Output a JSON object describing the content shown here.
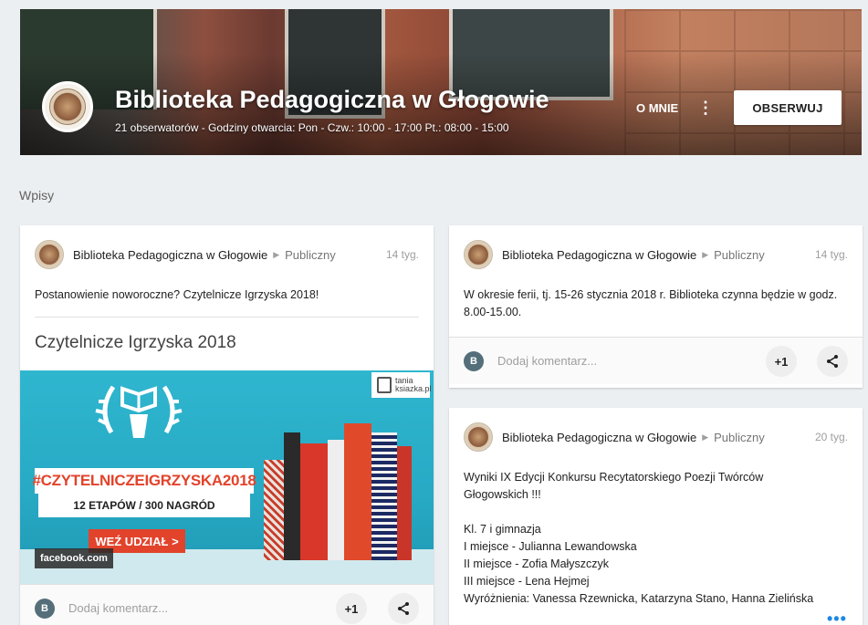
{
  "header": {
    "title": "Biblioteka Pedagogiczna w Głogowie",
    "subtitle": "21 obserwatorów - Godziny otwarcia: Pon - Czw.: 10:00 - 17:00 Pt.: 08:00 - 15:00",
    "about_label": "O MNIE",
    "more_label": "⋮",
    "follow_label": "OBSERWUJ"
  },
  "section_label": "Wpisy",
  "posts": [
    {
      "author": "Biblioteka Pedagogiczna w Głogowie",
      "visibility": "Publiczny",
      "time": "14 tyg.",
      "text": "Postanowienie noworoczne? Czytelnicze Igrzyska 2018!",
      "link_title": "Czytelnicze Igrzyska 2018",
      "preview": {
        "hashtag": "#CZYTELNICZEIGRZYSKA2018",
        "stages": "12 ETAPÓW / 300 NAGRÓD",
        "cta": "WEŹ UDZIAŁ >",
        "brand_top": "tania",
        "brand_bottom": "ksiazka.pl",
        "source": "facebook.com"
      },
      "comment_avatar": "B",
      "comment_placeholder": "Dodaj komentarz...",
      "plus_one": "+1"
    },
    {
      "author": "Biblioteka Pedagogiczna w Głogowie",
      "visibility": "Publiczny",
      "time": "14 tyg.",
      "text": "W okresie ferii, tj. 15-26 stycznia 2018 r. Biblioteka czynna będzie w godz. 8.00-15.00.",
      "comment_avatar": "B",
      "comment_placeholder": "Dodaj komentarz...",
      "plus_one": "+1"
    },
    {
      "author": "Biblioteka Pedagogiczna w Głogowie",
      "visibility": "Publiczny",
      "time": "20 tyg.",
      "lines": [
        "Wyniki IX Edycji Konkursu Recytatorskiego Poezji Twórców",
        "Głogowskich !!!",
        "",
        "Kl. 7 i gimnazja",
        "I miejsce - Julianna Lewandowska",
        "II miejsce - Zofia Małyszczyk",
        "III miejsce - Lena Hejmej",
        "Wyróżnienia: Vanessa Rzewnicka, Katarzyna Stano, Hanna Zielińska"
      ],
      "more_label": "•••"
    }
  ]
}
